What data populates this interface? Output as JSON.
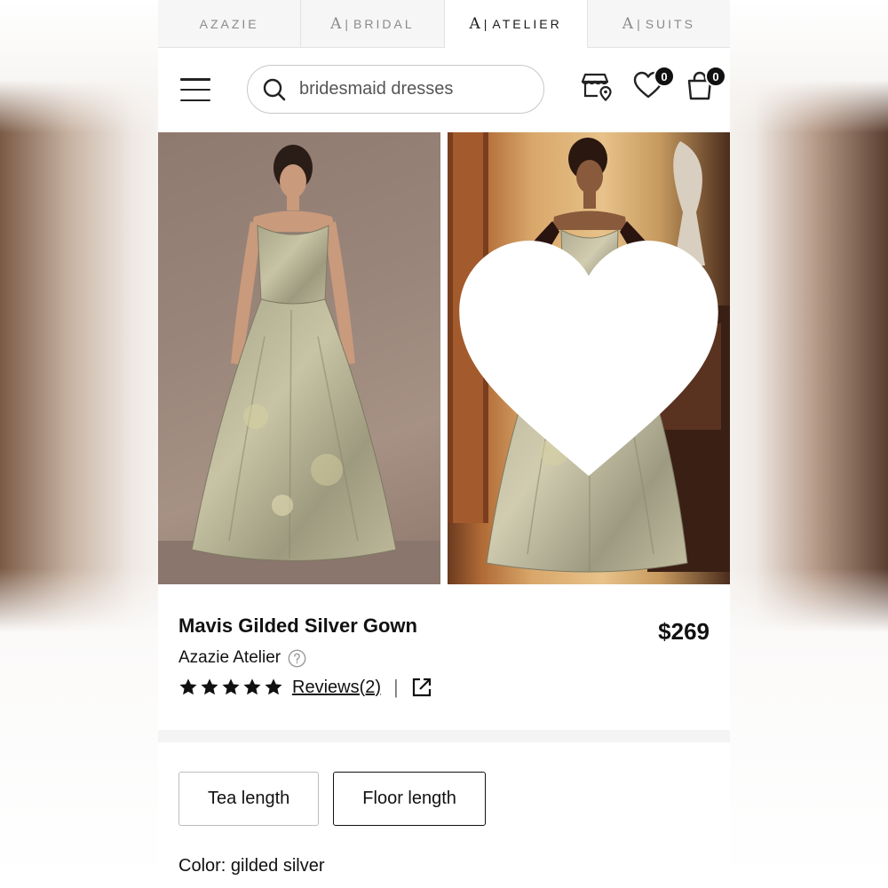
{
  "brand_tabs": [
    {
      "prefix": "",
      "label": "AZAZIE"
    },
    {
      "prefix": "A",
      "label": "BRIDAL"
    },
    {
      "prefix": "A",
      "label": "ATELIER"
    },
    {
      "prefix": "A",
      "label": "SUITS"
    }
  ],
  "active_brand_tab": "ATELIER",
  "search": {
    "value": "bridesmaid dresses"
  },
  "header": {
    "wishlist_count": "0",
    "cart_count": "0"
  },
  "product": {
    "name": "Mavis Gilded Silver Gown",
    "price": "$269",
    "brand": "Azazie Atelier",
    "rating_stars": 5,
    "reviews_label": "Reviews(2)"
  },
  "length_options": [
    "Tea length",
    "Floor length"
  ],
  "selected_length": "Floor length",
  "color_label": "Color: gilded silver",
  "colors": {
    "text": "#111111",
    "border": "#bdbdbd",
    "badge": "#111111"
  }
}
